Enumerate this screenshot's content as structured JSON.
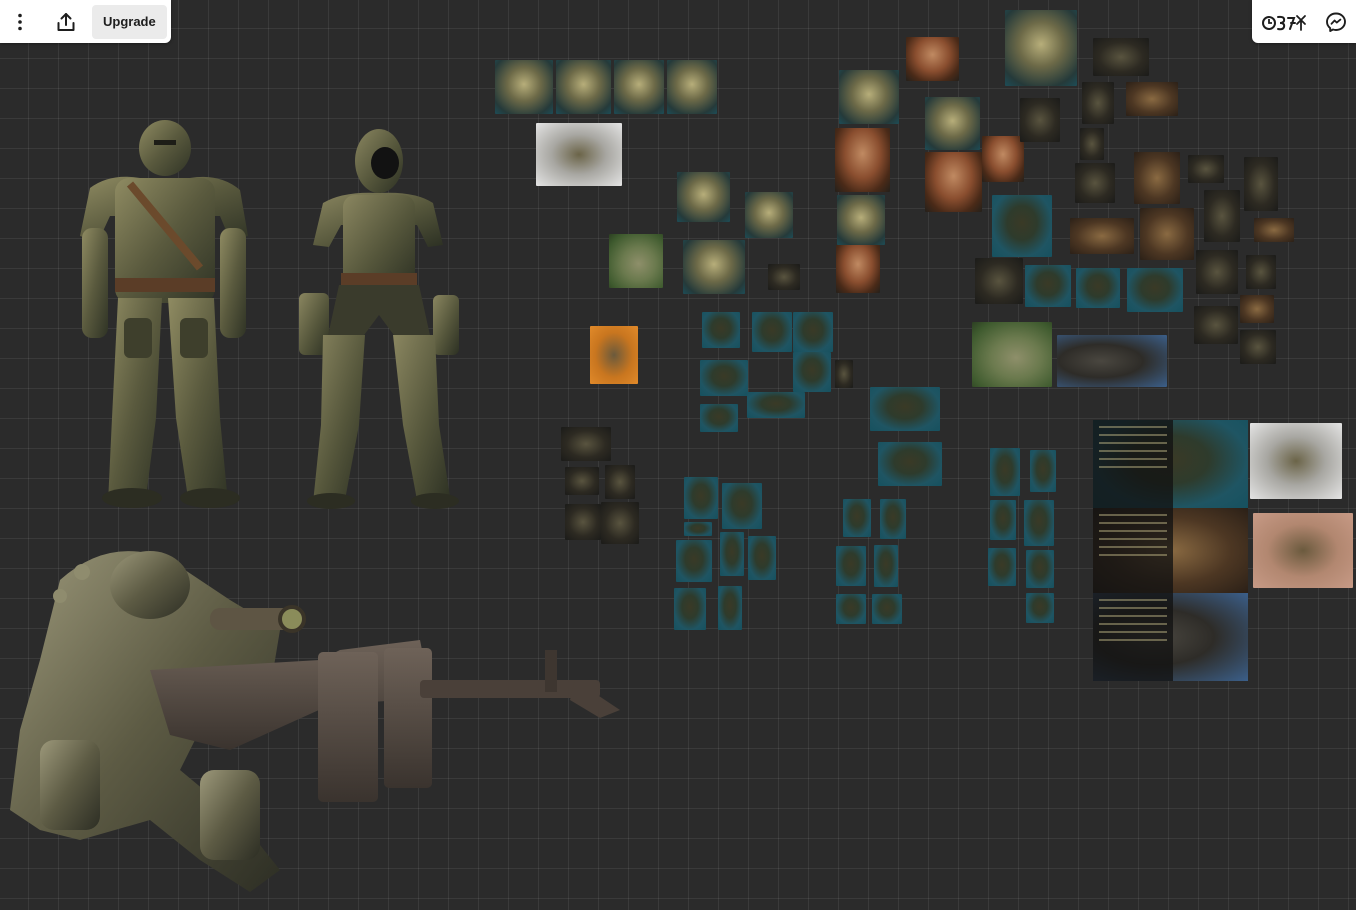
{
  "toolbar": {
    "menu_icon": "vertical-dots-icon",
    "share_icon": "share-upload-icon",
    "upgrade_label": "Upgrade"
  },
  "toolbar_right": {
    "brand_icon": "brand-logo-icon",
    "chat_icon": "messenger-chat-icon"
  },
  "colors": {
    "canvas_bg": "#2b2b2b",
    "grid": "rgba(255,255,255,0.07)",
    "toolbar_bg": "#ffffff",
    "upgrade_bg": "#ebebeb",
    "armor_bronze": "#6d6a48",
    "teal_backdrop": "#1f5563"
  }
}
